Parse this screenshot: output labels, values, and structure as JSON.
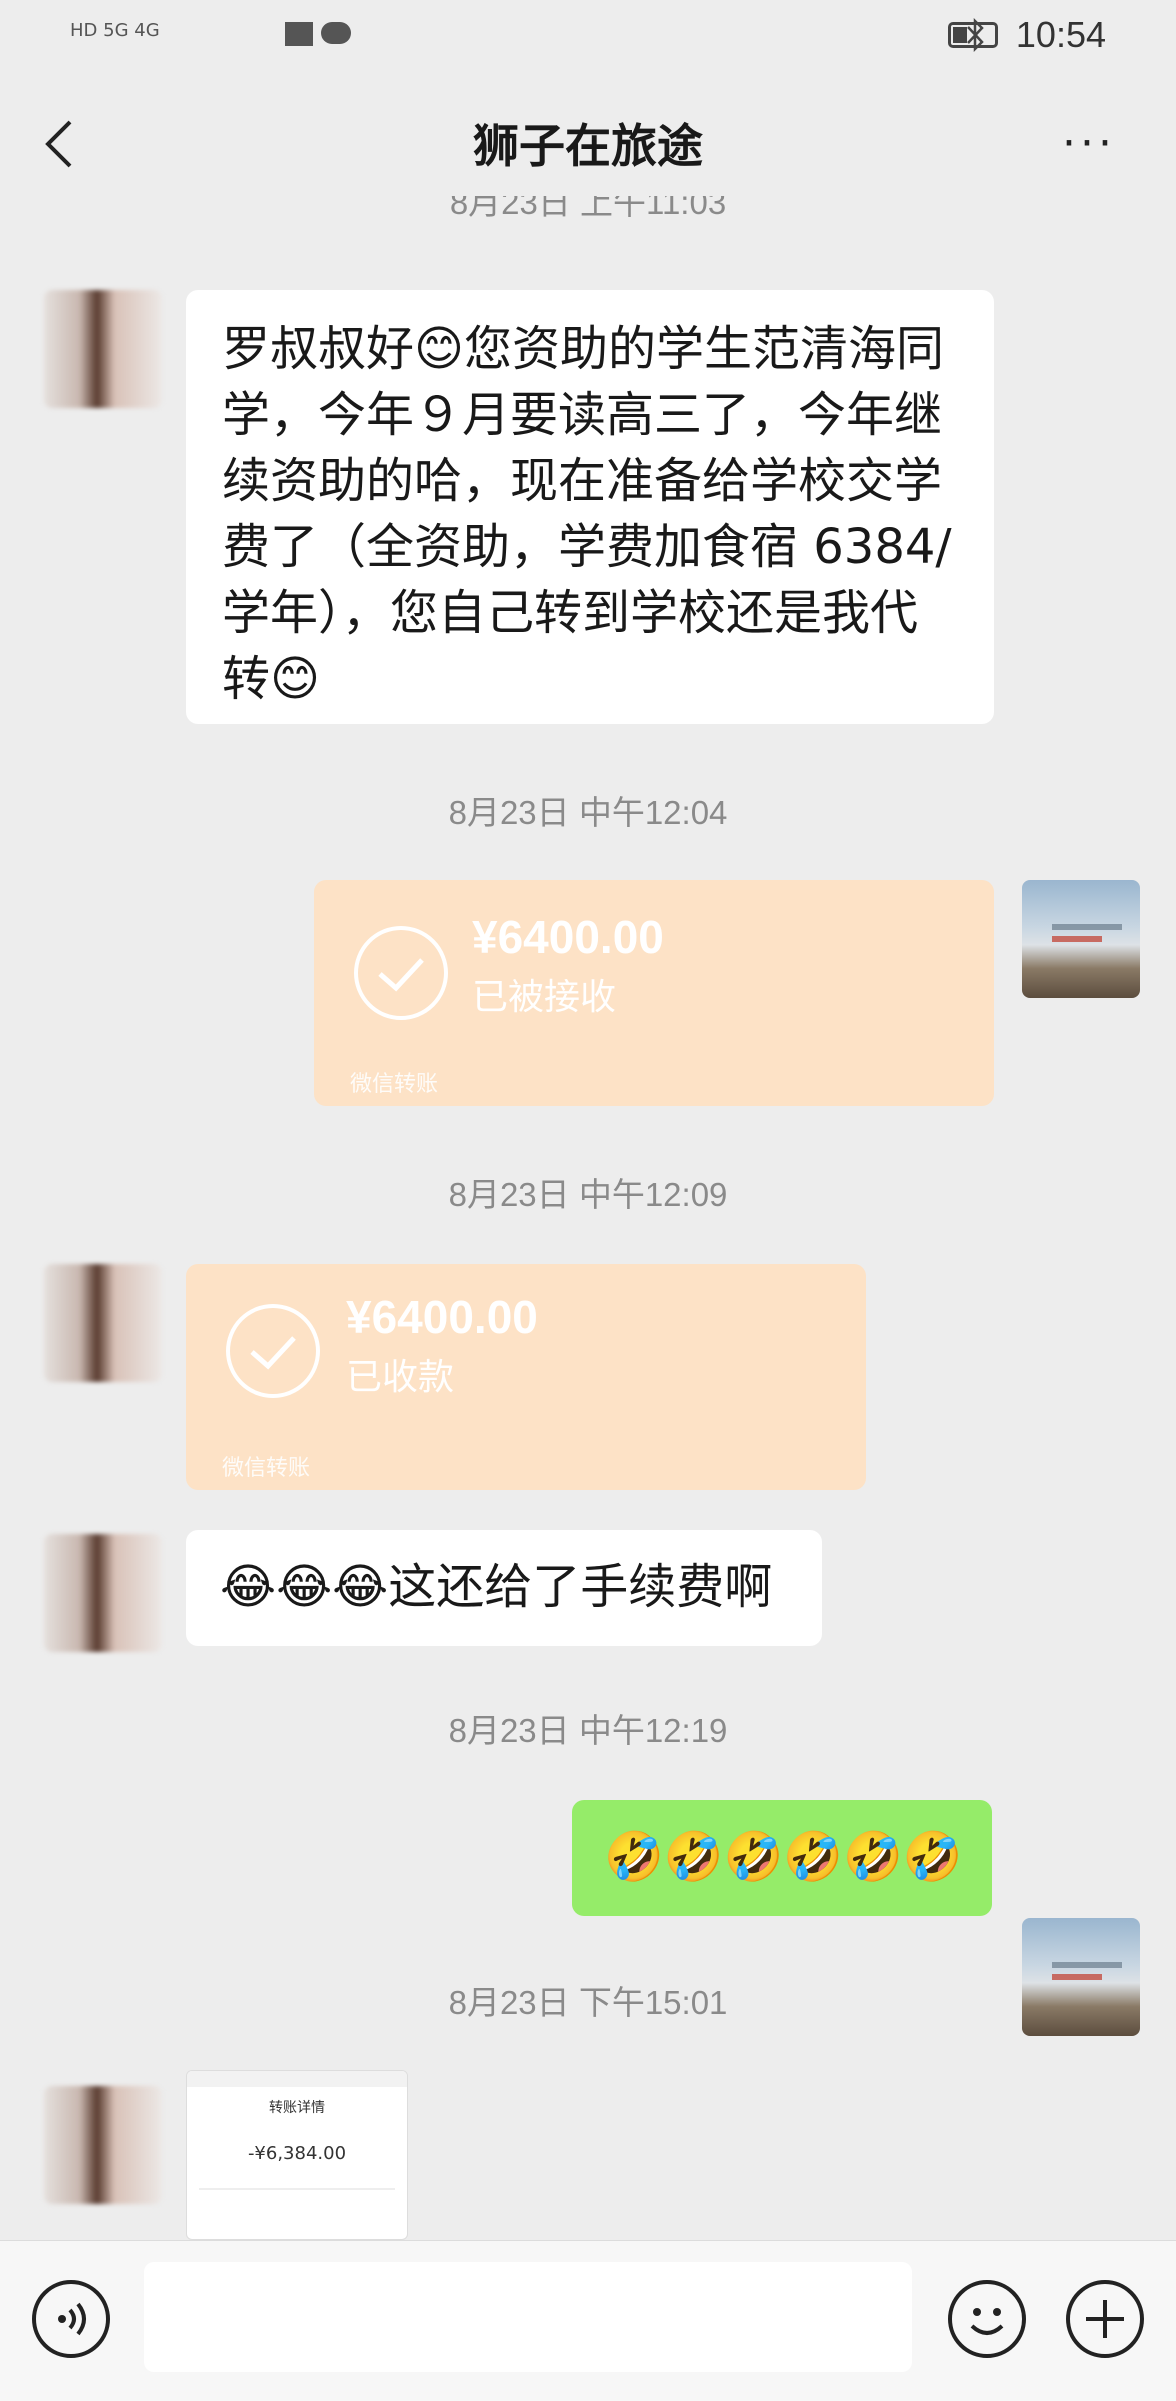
{
  "status_bar": {
    "network": "HD 5G 4G",
    "time": "10:54"
  },
  "header": {
    "title": "狮子在旅途",
    "more": "···"
  },
  "timestamps": [
    "8月23日 上午11:03",
    "8月23日 中午12:04",
    "8月23日 中午12:09",
    "8月23日 中午12:19",
    "8月23日 下午15:01"
  ],
  "messages": {
    "m1_text": "罗叔叔好😊您资助的学生范清海同学，今年９月要读高三了，今年继续资助的哈，现在准备给学校交学费了（全资助，学费加食宿 6384/学年），您自己转到学校还是我代转😊",
    "transfer_sent": {
      "amount": "¥6400.00",
      "status": "已被接收",
      "footer": "微信转账"
    },
    "transfer_recv": {
      "amount": "¥6400.00",
      "status": "已收款",
      "footer": "微信转账"
    },
    "m4_text": "😂😂😂这还给了手续费啊",
    "m5_text": "🤣🤣🤣🤣🤣🤣",
    "receipt": {
      "title": "转账详情",
      "amount": "-¥6,384.00"
    }
  },
  "colors": {
    "background": "#ededed",
    "bubble_green": "#95ec69",
    "transfer": "#fde2c6"
  }
}
